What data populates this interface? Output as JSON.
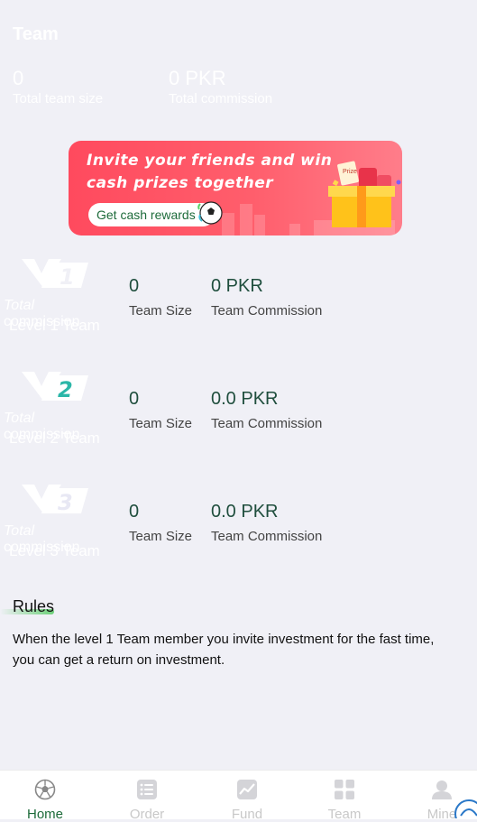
{
  "header": {
    "title": "Team",
    "team_size_value": "0",
    "team_size_label": "Total team size",
    "commission_value": "0 PKR",
    "commission_label": "Total commission"
  },
  "banner": {
    "line1": "Invite your friends and win",
    "line2": "cash prizes together",
    "button_label": "Get cash rewards",
    "gift_tag": "Prize"
  },
  "levels": [
    {
      "badge": "1",
      "watermark_italic": "Total",
      "watermark_rest": " commission",
      "name": "Level 1 Team",
      "team_size": "0",
      "team_size_label": "Team Size",
      "commission": "0 PKR",
      "commission_label": "Team Commission"
    },
    {
      "badge": "2",
      "watermark_italic": "Total",
      "watermark_rest": " commission",
      "name": "Level 2 Team",
      "team_size": "0",
      "team_size_label": "Team Size",
      "commission": "0.0 PKR",
      "commission_label": "Team Commission"
    },
    {
      "badge": "3",
      "watermark_italic": "Total",
      "watermark_rest": " commission",
      "name": "Level 3 Team",
      "team_size": "0",
      "team_size_label": "Team Size",
      "commission": "0.0 PKR",
      "commission_label": "Team Commission"
    }
  ],
  "rules": {
    "title": "Rules",
    "text": "When the level 1 Team member you invite investment for the fast time, you can get a return on investment."
  },
  "nav": {
    "items": [
      {
        "label": "Home",
        "icon": "football-icon",
        "active": true
      },
      {
        "label": "Order",
        "icon": "list-icon",
        "active": false
      },
      {
        "label": "Fund",
        "icon": "chart-icon",
        "active": false
      },
      {
        "label": "Team",
        "icon": "grid-icon",
        "active": false
      },
      {
        "label": "Mine",
        "icon": "person-icon",
        "active": false
      }
    ]
  },
  "colors": {
    "accent": "#1d6b3a",
    "banner": "#ff5e6c",
    "background": "#f0f0f6"
  }
}
